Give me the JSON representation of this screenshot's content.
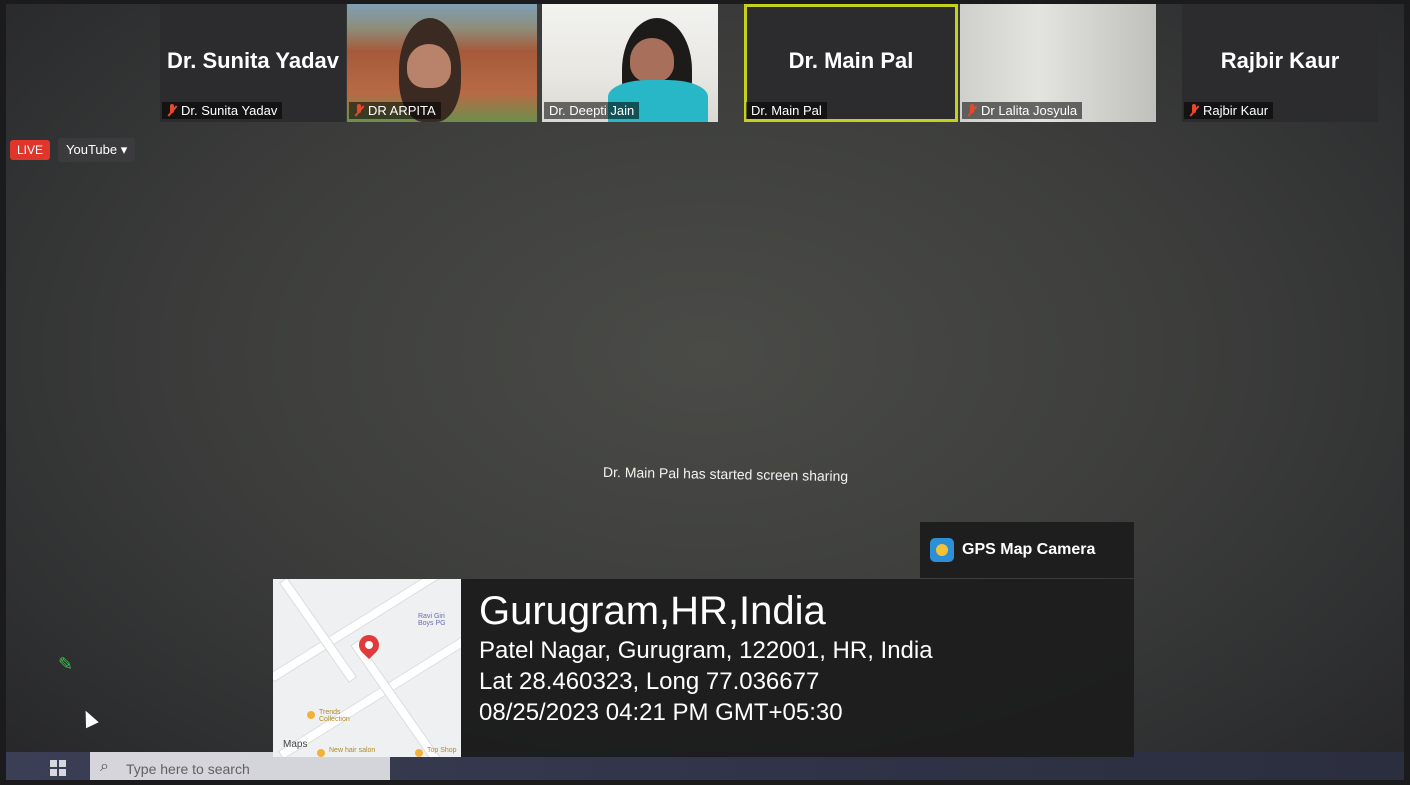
{
  "participants": [
    {
      "name": "Dr. Sunita Yadav",
      "caption": "Dr. Sunita Yadav",
      "muted": true
    },
    {
      "caption": "DR ARPITA",
      "muted": true
    },
    {
      "caption": "Dr. Deepti Jain",
      "muted": false
    },
    {
      "name": "Dr. Main Pal",
      "caption": "Dr. Main Pal",
      "muted": false
    },
    {
      "caption": "Dr Lalita Josyula",
      "muted": true
    },
    {
      "name": "Rajbir Kaur",
      "caption": "Rajbir Kaur",
      "muted": true
    }
  ],
  "stream": {
    "live_label": "LIVE",
    "platform": "YouTube"
  },
  "share_notice": "Dr. Main Pal has started screen sharing",
  "gps": {
    "app_name": "GPS Map Camera",
    "city": "Gurugram,HR,India",
    "address": "Patel Nagar, Gurugram, 122001, HR, India",
    "coords": "Lat 28.460323, Long 77.036677",
    "datetime": "08/25/2023 04:21 PM GMT+05:30",
    "map_labels": {
      "poi1": "Ravi Giri Boys PG",
      "poi2": "Trends Collection",
      "poi3": "New hair salon",
      "poi4": "Top Shop",
      "maps": "Maps"
    }
  },
  "taskbar": {
    "search_placeholder": "Type here to search"
  },
  "colors": {
    "live": "#e0352b",
    "active_border": "#c6d11f",
    "mic_off": "#e8482a"
  }
}
